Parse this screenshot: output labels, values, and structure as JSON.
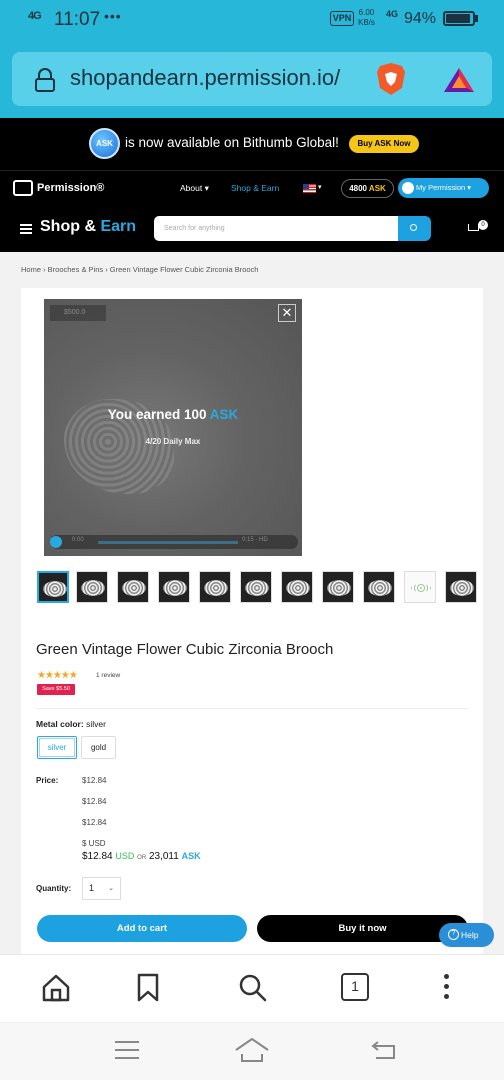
{
  "status_bar": {
    "signal": "4G",
    "time": "11:07",
    "dots": "•••",
    "vpn": "VPN",
    "speed_value": "6.00",
    "speed_unit": "KB/s",
    "network": "4G",
    "battery": "94%"
  },
  "browser": {
    "url": "shopandearn.permission.io/"
  },
  "banner": {
    "coin_label": "ASK",
    "text": "is now available on Bithumb Global!",
    "button": "Buy ASK Now"
  },
  "permission_nav": {
    "brand": "Permission®",
    "about": "About ▾",
    "shop_earn": "Shop & Earn",
    "flag_caret": "▾",
    "ask_amount": "4800",
    "ask_unit": "ASK",
    "my_permission": "My Permission ▾"
  },
  "shop_header": {
    "logo_shop": "Shop",
    "logo_amp": " & ",
    "logo_earn": "Earn",
    "search_placeholder": "Search for anything",
    "cart_count": "0"
  },
  "breadcrumb": "Home › Brooches & Pins › Green Vintage Flower Cubic Zirconia Brooch",
  "video_overlay": {
    "tag": "$500.0",
    "close": "✕",
    "earned_prefix": "You earned 100 ",
    "earned_unit": "ASK",
    "daily_max": "4/20 Daily Max",
    "time_current": "0:00",
    "time_total": "0:15 · HD"
  },
  "product": {
    "title": "Green Vintage Flower Cubic Zirconia Brooch",
    "stars": "★★★★★",
    "rating": 5,
    "reviews": "1 review",
    "save_badge": "Save $5.50",
    "metal_label": "Metal color:",
    "metal_value": "silver",
    "options": [
      "silver",
      "gold"
    ],
    "price_label": "Price:",
    "prices": [
      "$12.84",
      "$12.84",
      "$12.84"
    ],
    "currency_line": "$ USD",
    "price_main": "$12.84",
    "price_currency": "USD",
    "price_or": "OR",
    "price_ask": "23,011",
    "price_ask_unit": "ASK",
    "qty_label": "Quantity:",
    "qty_value": "1",
    "qty_caret": "⌄",
    "add_to_cart": "Add to cart",
    "buy_now": "Buy it now"
  },
  "help": {
    "icon": "?",
    "label": "Help"
  },
  "browser_toolbar": {
    "tab_count": "1"
  },
  "icons": [
    "home-icon",
    "bookmark-icon",
    "search-icon",
    "tabs-icon",
    "menu-icon",
    "android-menu-icon",
    "android-home-icon",
    "android-back-icon"
  ],
  "colors": {
    "accent": "#2aa8e0",
    "browser_bar": "#27b7d9",
    "header_bg": "#000000",
    "sale": "#e0224e",
    "star": "#f5a623",
    "ask_yellow": "#f5c518"
  }
}
